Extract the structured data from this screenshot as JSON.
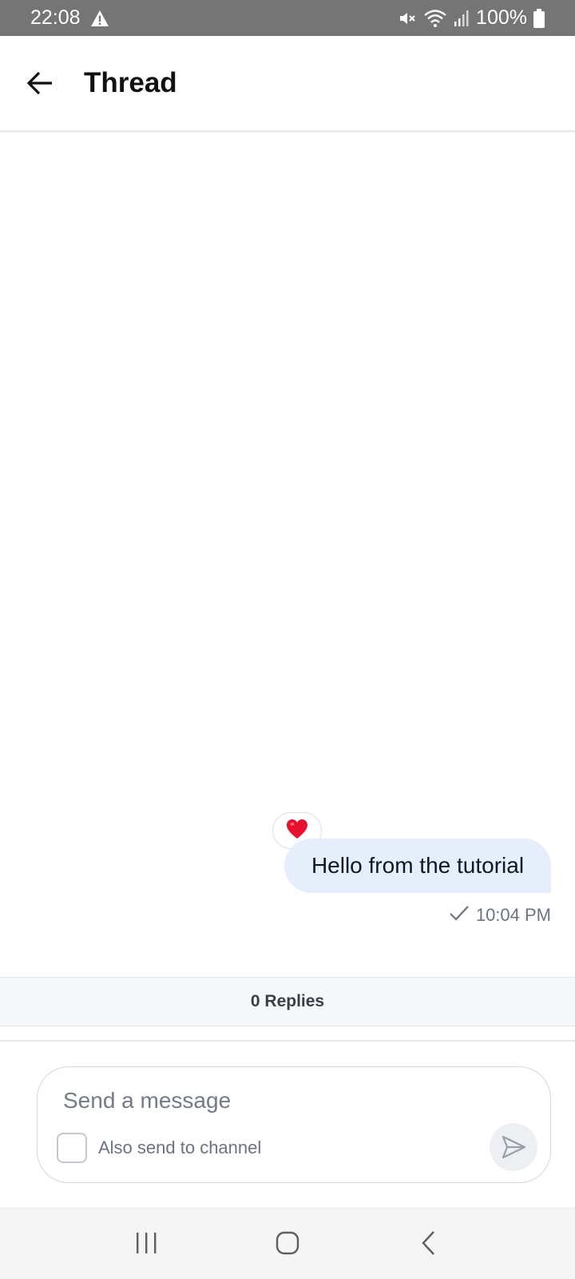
{
  "status_bar": {
    "time": "22:08",
    "battery": "100%",
    "icons": [
      "warning-icon",
      "mute-icon",
      "wifi-icon",
      "signal-icon",
      "battery-icon"
    ]
  },
  "header": {
    "title": "Thread",
    "back_icon": "arrow-left-icon"
  },
  "message": {
    "text": "Hello from the tutorial",
    "time": "10:04 PM",
    "status_icon": "check-icon",
    "reaction": "❤️"
  },
  "replies": {
    "label": "0 Replies"
  },
  "composer": {
    "placeholder": "Send a message",
    "value": "",
    "checkbox_label": "Also send to channel",
    "checkbox_checked": false,
    "send_icon": "send-icon"
  },
  "nav_bar": {
    "icons": [
      "recent-apps-icon",
      "home-icon",
      "back-icon"
    ]
  },
  "colors": {
    "status_bar": "#757575",
    "bubble": "#e6eefc",
    "replies_bar": "#f6f7f9",
    "nav_bar": "#f5f5f5"
  }
}
